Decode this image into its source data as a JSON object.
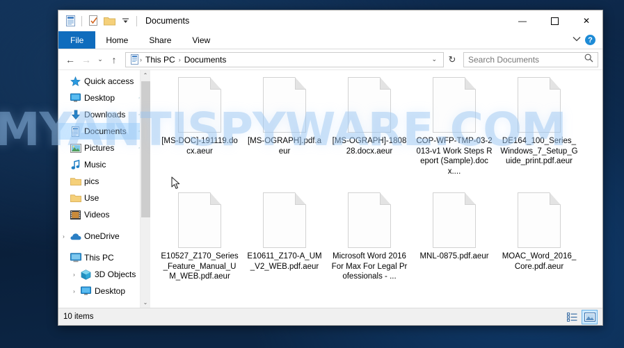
{
  "desktop": {
    "watermark": "MYANTISPYWARE.COM",
    "background_color": "#0d2847",
    "watermark_color": "#96c3f0"
  },
  "window": {
    "title": "Documents",
    "accent_color": "#0f6cbd",
    "quick_access_toolbar": [
      {
        "name": "properties-icon",
        "label": "Properties"
      },
      {
        "name": "new-folder-icon",
        "label": "New folder"
      },
      {
        "name": "folder-icon",
        "label": "Folder"
      },
      {
        "name": "customize-dropdown-icon",
        "label": "Customize Quick Access Toolbar"
      }
    ],
    "controls": {
      "minimize": "—",
      "maximize": "☐",
      "close": "✕"
    }
  },
  "ribbon": {
    "tabs": [
      {
        "label": "File",
        "active": true
      },
      {
        "label": "Home",
        "active": false
      },
      {
        "label": "Share",
        "active": false
      },
      {
        "label": "View",
        "active": false
      }
    ],
    "collapse_label": "⌄",
    "help_label": "?"
  },
  "address_bar": {
    "back_icon": "←",
    "forward_icon": "→",
    "recent_icon": "⌄",
    "up_icon": "↑",
    "breadcrumbs": [
      "This PC",
      "Documents"
    ],
    "separator": "›",
    "dropdown_icon": "⌄",
    "refresh_icon": "↻"
  },
  "search": {
    "placeholder": "Search Documents",
    "value": "",
    "icon": "search-icon"
  },
  "sidebar": {
    "groups": [
      {
        "name": "quick-access",
        "chevron": "ⱟ",
        "icon": "star-icon",
        "label": "Quick access",
        "level": 1,
        "items": [
          {
            "label": "Desktop",
            "icon": "desktop-icon",
            "pinned": true,
            "selected": false
          },
          {
            "label": "Downloads",
            "icon": "download-icon",
            "pinned": true,
            "selected": false
          },
          {
            "label": "Documents",
            "icon": "document-icon",
            "pinned": true,
            "selected": true
          },
          {
            "label": "Pictures",
            "icon": "pictures-icon",
            "pinned": true,
            "selected": false
          },
          {
            "label": "Music",
            "icon": "music-icon",
            "pinned": false,
            "selected": false
          },
          {
            "label": "pics",
            "icon": "folder-icon",
            "pinned": false,
            "selected": false
          },
          {
            "label": "Use",
            "icon": "folder-icon",
            "pinned": false,
            "selected": false
          },
          {
            "label": "Videos",
            "icon": "videos-icon",
            "pinned": false,
            "selected": false
          }
        ]
      },
      {
        "name": "onedrive",
        "chevron": "›",
        "icon": "cloud-icon",
        "label": "OneDrive",
        "level": 1,
        "items": []
      },
      {
        "name": "this-pc",
        "chevron": "ⱟ",
        "icon": "computer-icon",
        "label": "This PC",
        "level": 1,
        "items": [
          {
            "label": "3D Objects",
            "icon": "3d-objects-icon",
            "chevron": "›",
            "pinned": false,
            "selected": false
          },
          {
            "label": "Desktop",
            "icon": "desktop-icon",
            "chevron": "›",
            "pinned": false,
            "selected": false
          }
        ]
      }
    ],
    "scrollbar": {
      "up_arrow": "⌃",
      "down_arrow": "⌄"
    }
  },
  "files": [
    {
      "name": "[MS-DOC]-191119.docx.aeur",
      "icon": "generic-file-icon"
    },
    {
      "name": "[MS-OGRAPH].pdf.aeur",
      "icon": "generic-file-icon"
    },
    {
      "name": "[MS-OGRAPH]-180828.docx.aeur",
      "icon": "generic-file-icon"
    },
    {
      "name": "COP-WFP-TMP-03-2013-v1 Work Steps Report (Sample).docx....",
      "icon": "generic-file-icon"
    },
    {
      "name": "DE164_100_Series_Windows_7_Setup_Guide_print.pdf.aeur",
      "icon": "generic-file-icon"
    },
    {
      "name": "E10527_Z170_Series_Feature_Manual_UM_WEB.pdf.aeur",
      "icon": "generic-file-icon"
    },
    {
      "name": "E10611_Z170-A_UM_V2_WEB.pdf.aeur",
      "icon": "generic-file-icon"
    },
    {
      "name": "Microsoft Word 2016 For Max For Legal Professionals - ...",
      "icon": "generic-file-icon"
    },
    {
      "name": "MNL-0875.pdf.aeur",
      "icon": "generic-file-icon"
    },
    {
      "name": "MOAC_Word_2016_Core.pdf.aeur",
      "icon": "generic-file-icon"
    }
  ],
  "status_bar": {
    "item_count": "10 items",
    "views": [
      {
        "name": "details-view",
        "active": false
      },
      {
        "name": "large-icons-view",
        "active": true
      }
    ]
  }
}
